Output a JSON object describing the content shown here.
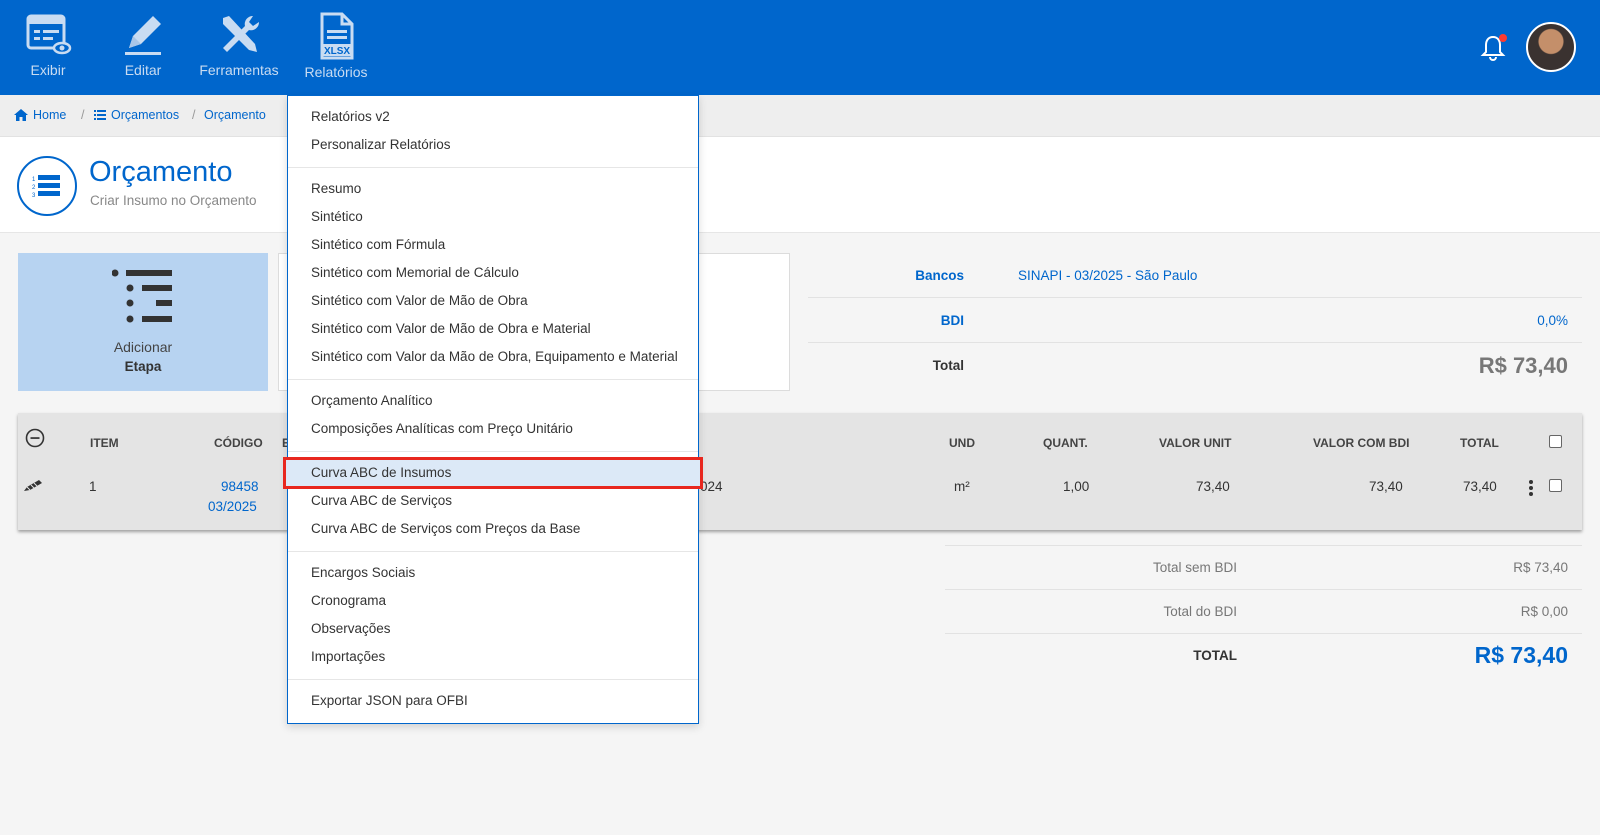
{
  "toolbar": {
    "items": [
      {
        "label": "Exibir",
        "icon": "view-list-icon"
      },
      {
        "label": "Editar",
        "icon": "pencil-icon"
      },
      {
        "label": "Ferramentas",
        "icon": "tools-icon"
      },
      {
        "label": "Relatórios",
        "icon": "xlsx-file-icon",
        "badge": "XLSX"
      }
    ]
  },
  "breadcrumb": {
    "home": "Home",
    "budgets": "Orçamentos",
    "current": "Orçamento"
  },
  "header": {
    "title": "Orçamento",
    "subtitle": "Criar Insumo no Orçamento"
  },
  "add_card": {
    "line1": "Adicionar",
    "line2": "Etapa"
  },
  "info": {
    "bancos_label": "Bancos",
    "bancos_value": "SINAPI - 03/2025 - São Paulo",
    "bdi_label": "BDI",
    "bdi_value": "0,0%",
    "total_label": "Total",
    "total_value": "R$ 73,40"
  },
  "table": {
    "headers": {
      "item": "ITEM",
      "codigo": "CÓDIGO",
      "desc_fragment": "E",
      "und": "UND",
      "quant": "QUANT.",
      "valor_unit": "VALOR UNIT",
      "valor_bdi": "VALOR COM BDI",
      "total": "TOTAL"
    },
    "rows": [
      {
        "item": "1",
        "code": "98458",
        "code_date": "03/2025",
        "desc_fragment": "024",
        "und": "m²",
        "quant": "1,00",
        "valor_unit": "73,40",
        "valor_bdi": "73,40",
        "total": "73,40"
      }
    ]
  },
  "totals": {
    "sem_bdi_label": "Total sem BDI",
    "sem_bdi_value": "R$ 73,40",
    "do_bdi_label": "Total do BDI",
    "do_bdi_value": "R$ 0,00",
    "total_label": "TOTAL",
    "total_value": "R$ 73,40"
  },
  "menu": {
    "items": [
      "Relatórios v2",
      "Personalizar Relatórios",
      "Resumo",
      "Sintético",
      "Sintético com Fórmula",
      "Sintético com Memorial de Cálculo",
      "Sintético com Valor de Mão de Obra",
      "Sintético com Valor de Mão de Obra e Material",
      "Sintético com Valor da Mão de Obra, Equipamento e Material",
      "Orçamento Analítico",
      "Composições Analíticas com Preço Unitário",
      "Curva ABC de Insumos",
      "Curva ABC de Serviços",
      "Curva ABC de Serviços com Preços da Base",
      "Encargos Sociais",
      "Cronograma",
      "Observações",
      "Importações",
      "Exportar JSON para OFBI"
    ],
    "highlighted": "Curva ABC de Insumos"
  },
  "colors": {
    "primary": "#0066cc",
    "highlight_border": "#e8271e",
    "card_bg": "#b7d3f1"
  }
}
